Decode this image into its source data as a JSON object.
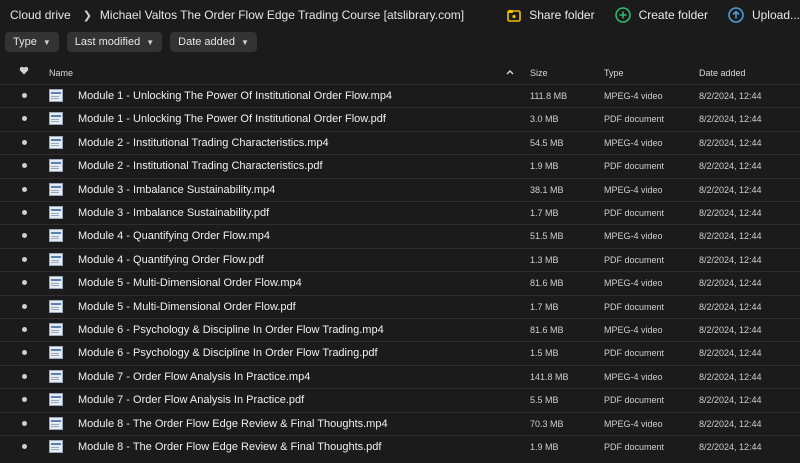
{
  "breadcrumb": {
    "root": "Cloud drive",
    "folder": "Michael Valtos The Order Flow Edge Trading Course [atslibrary.com]"
  },
  "actions": {
    "share": "Share folder",
    "create": "Create folder",
    "upload": "Upload..."
  },
  "filters": {
    "type": "Type",
    "modified": "Last modified",
    "added": "Date added"
  },
  "columns": {
    "name": "Name",
    "size": "Size",
    "type": "Type",
    "date": "Date added",
    "sort_icon": "caret-up-icon"
  },
  "colors": {
    "accent_yellow": "#f2c100",
    "accent_green": "#2fbf71",
    "accent_blue": "#4aa3e0"
  },
  "files": [
    {
      "name": "Module 1 - Unlocking The Power Of Institutional Order Flow.mp4",
      "size": "111.8 MB",
      "type": "MPEG-4 video",
      "date": "8/2/2024, 12:44"
    },
    {
      "name": "Module 1 - Unlocking The Power Of Institutional Order Flow.pdf",
      "size": "3.0 MB",
      "type": "PDF document",
      "date": "8/2/2024, 12:44"
    },
    {
      "name": "Module 2 - Institutional Trading Characteristics.mp4",
      "size": "54.5 MB",
      "type": "MPEG-4 video",
      "date": "8/2/2024, 12:44"
    },
    {
      "name": "Module 2 - Institutional Trading Characteristics.pdf",
      "size": "1.9 MB",
      "type": "PDF document",
      "date": "8/2/2024, 12:44"
    },
    {
      "name": "Module 3 - Imbalance Sustainability.mp4",
      "size": "38.1 MB",
      "type": "MPEG-4 video",
      "date": "8/2/2024, 12:44"
    },
    {
      "name": "Module 3 - Imbalance Sustainability.pdf",
      "size": "1.7 MB",
      "type": "PDF document",
      "date": "8/2/2024, 12:44"
    },
    {
      "name": "Module 4 - Quantifying Order Flow.mp4",
      "size": "51.5 MB",
      "type": "MPEG-4 video",
      "date": "8/2/2024, 12:44"
    },
    {
      "name": "Module 4 - Quantifying Order Flow.pdf",
      "size": "1.3 MB",
      "type": "PDF document",
      "date": "8/2/2024, 12:44"
    },
    {
      "name": "Module 5 - Multi-Dimensional Order Flow.mp4",
      "size": "81.6 MB",
      "type": "MPEG-4 video",
      "date": "8/2/2024, 12:44"
    },
    {
      "name": "Module 5 - Multi-Dimensional Order Flow.pdf",
      "size": "1.7 MB",
      "type": "PDF document",
      "date": "8/2/2024, 12:44"
    },
    {
      "name": "Module 6 - Psychology & Discipline In Order Flow Trading.mp4",
      "size": "81.6 MB",
      "type": "MPEG-4 video",
      "date": "8/2/2024, 12:44"
    },
    {
      "name": "Module 6 - Psychology & Discipline In Order Flow Trading.pdf",
      "size": "1.5 MB",
      "type": "PDF document",
      "date": "8/2/2024, 12:44"
    },
    {
      "name": "Module 7 - Order Flow Analysis In Practice.mp4",
      "size": "141.8 MB",
      "type": "MPEG-4 video",
      "date": "8/2/2024, 12:44"
    },
    {
      "name": "Module 7 - Order Flow Analysis In Practice.pdf",
      "size": "5.5 MB",
      "type": "PDF document",
      "date": "8/2/2024, 12:44"
    },
    {
      "name": "Module 8 - The Order Flow Edge Review & Final Thoughts.mp4",
      "size": "70.3 MB",
      "type": "MPEG-4 video",
      "date": "8/2/2024, 12:44"
    },
    {
      "name": "Module 8 - The Order Flow Edge Review & Final Thoughts.pdf",
      "size": "1.9 MB",
      "type": "PDF document",
      "date": "8/2/2024, 12:44"
    }
  ]
}
